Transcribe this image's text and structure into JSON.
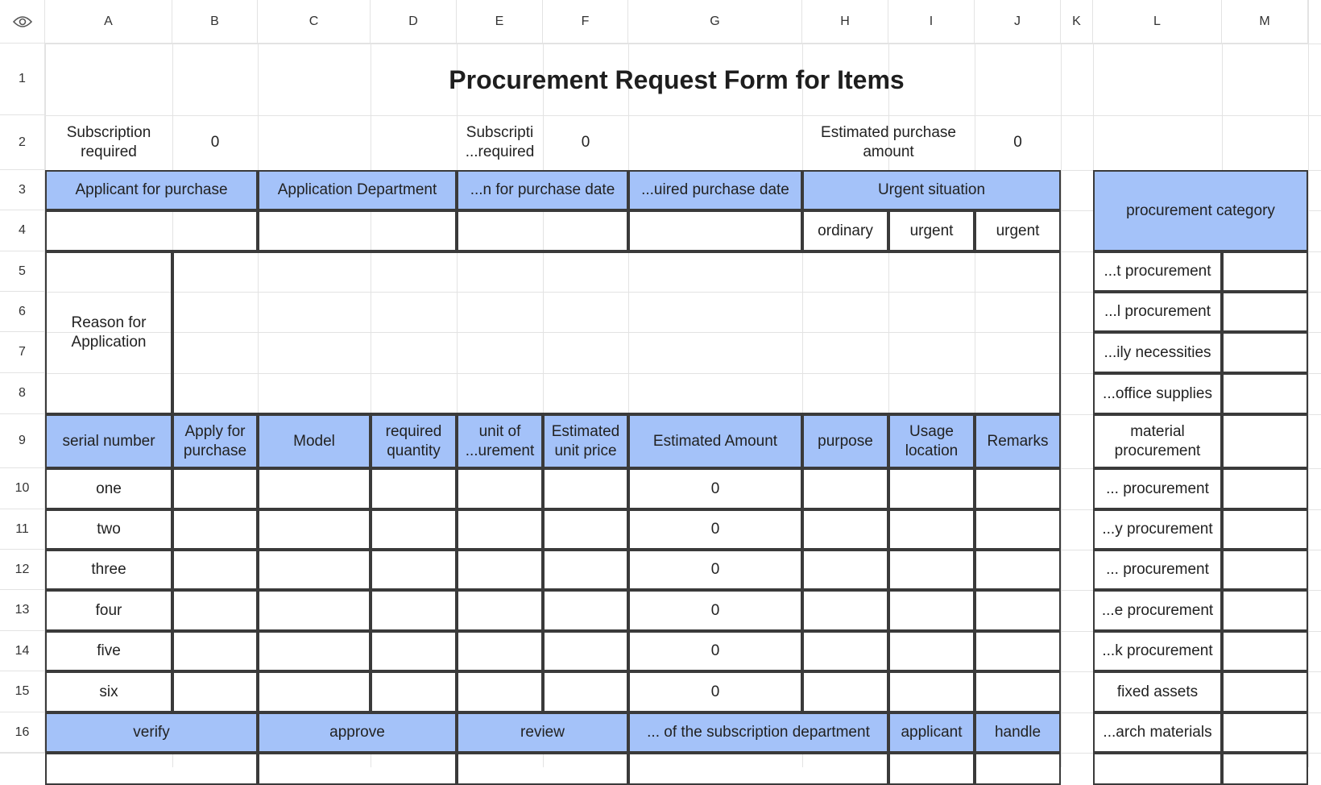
{
  "columns": [
    "A",
    "B",
    "C",
    "D",
    "E",
    "F",
    "G",
    "H",
    "I",
    "J",
    "K",
    "L",
    "M"
  ],
  "rows": [
    "1",
    "2",
    "3",
    "4",
    "5",
    "6",
    "7",
    "8",
    "9",
    "10",
    "11",
    "12",
    "13",
    "14",
    "15",
    "16"
  ],
  "title": "Procurement Request Form for Items",
  "row2": {
    "label1": "Subscription required",
    "value1": "0",
    "label2": "Subscripti ...required",
    "value2": "0",
    "label3": "Estimated purchase amount",
    "value3": "0"
  },
  "header3": {
    "applicant": "Applicant for purchase",
    "department": "Application Department",
    "app_date": "...n for purchase date",
    "req_date": "...uired purchase date",
    "urgent": "Urgent situation",
    "category": "procurement category"
  },
  "row4": {
    "ordinary": "ordinary",
    "urgent1": "urgent",
    "urgent2": "urgent"
  },
  "reason": "Reason for Application",
  "table_headers": [
    "serial number",
    "Apply for purchase",
    "Model",
    "required quantity",
    "unit of ...urement",
    "Estimated unit price",
    "Estimated Amount",
    "purpose",
    "Usage location",
    "Remarks"
  ],
  "items": [
    {
      "serial": "one",
      "amount": "0"
    },
    {
      "serial": "two",
      "amount": "0"
    },
    {
      "serial": "three",
      "amount": "0"
    },
    {
      "serial": "four",
      "amount": "0"
    },
    {
      "serial": "five",
      "amount": "0"
    },
    {
      "serial": "six",
      "amount": "0"
    }
  ],
  "categories": [
    "...t procurement",
    "...l procurement",
    "...ily necessities",
    "...office supplies",
    "material procurement",
    "... procurement",
    "...y procurement",
    "... procurement",
    "...e procurement",
    "...k procurement",
    "fixed assets",
    "...arch materials"
  ],
  "footer": {
    "verify": "verify",
    "approve": "approve",
    "review": "review",
    "subscription_dept": "... of the subscription department",
    "applicant": "applicant",
    "handle": "handle"
  },
  "icons": {
    "corner": "eye-icon"
  }
}
